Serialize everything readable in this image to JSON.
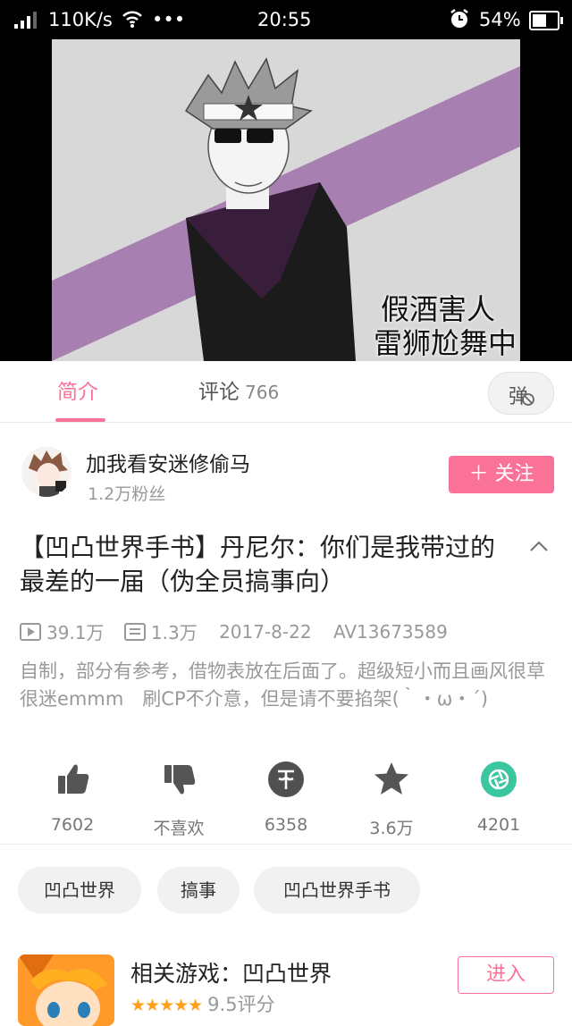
{
  "status_bar": {
    "speed": "110K/s",
    "dots": "•••",
    "time": "20:55",
    "battery": "54%"
  },
  "video": {
    "caption_line1": "假酒害人",
    "caption_line2": "雷狮尬舞中"
  },
  "tabs": {
    "intro": "简介",
    "comments": "评论",
    "comment_count": "766",
    "danmaku_icon": "弹"
  },
  "uploader": {
    "name": "加我看安迷修偷马",
    "fans": "1.2万粉丝",
    "follow_label": "＋ 关注"
  },
  "video_info": {
    "title": "【凹凸世界手书】丹尼尔：你们是我带过的最差的一届（伪全员搞事向）",
    "views": "39.1万",
    "danmaku": "1.3万",
    "date": "2017-8-22",
    "av": "AV13673589",
    "description": "自制，部分有参考，借物表放在后面了。超级短小而且画风很草很迷emmm　刷CP不介意，但是请不要掐架(｀・ω・´)"
  },
  "actions": [
    {
      "icon": "thumbs-up-icon",
      "label": "7602"
    },
    {
      "icon": "thumbs-down-icon",
      "label": "不喜欢"
    },
    {
      "icon": "coin-icon",
      "label": "6358"
    },
    {
      "icon": "star-icon",
      "label": "3.6万"
    },
    {
      "icon": "share-icon",
      "label": "4201"
    }
  ],
  "tags": [
    "凹凸世界",
    "搞事",
    "凹凸世界手书"
  ],
  "related_game": {
    "title": "相关游戏：凹凸世界",
    "stars": "★★★★★",
    "rating": "9.5评分",
    "enter_label": "进入"
  },
  "colors": {
    "accent": "#fb7299",
    "coin": "#505050",
    "share": "#3cc6a0"
  }
}
